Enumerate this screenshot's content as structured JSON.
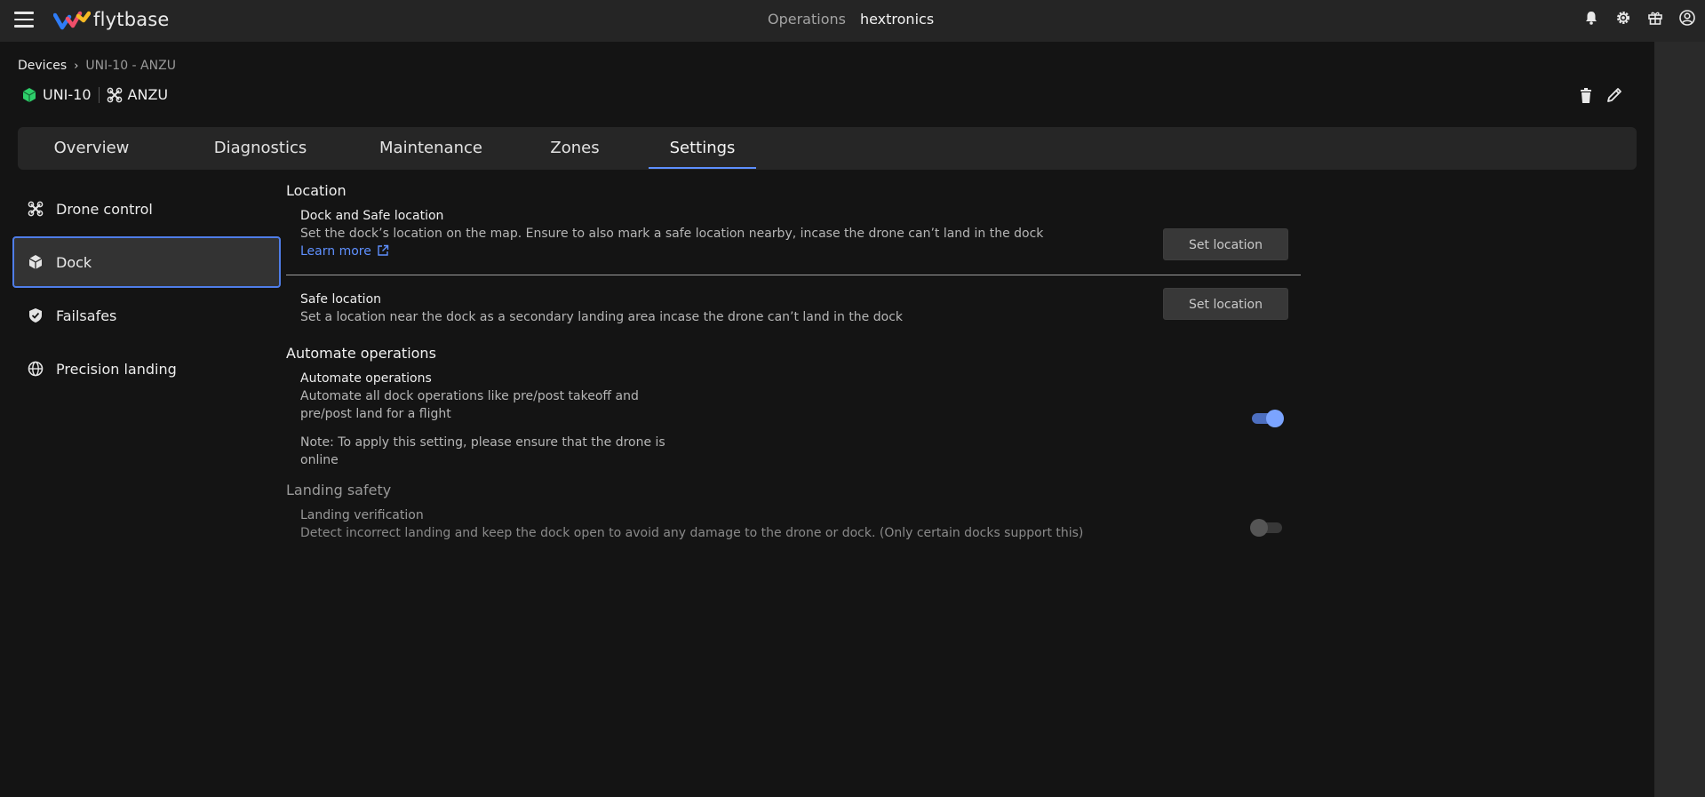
{
  "app": {
    "brand": "flytbase"
  },
  "topbar": {
    "operations_label": "Operations",
    "org_label": "hextronics"
  },
  "breadcrumb": {
    "root": "Devices",
    "current": "UNI-10 - ANZU"
  },
  "device": {
    "dock_name": "UNI-10",
    "drone_name": "ANZU"
  },
  "tabs": [
    {
      "label": "Overview"
    },
    {
      "label": "Diagnostics"
    },
    {
      "label": "Maintenance"
    },
    {
      "label": "Zones"
    },
    {
      "label": "Settings"
    }
  ],
  "active_tab": "Settings",
  "sidenav": [
    {
      "label": "Drone control",
      "icon": "drone-icon"
    },
    {
      "label": "Dock",
      "icon": "dock-cube-icon"
    },
    {
      "label": "Failsafes",
      "icon": "shield-check-icon"
    },
    {
      "label": "Precision landing",
      "icon": "globe-icon"
    }
  ],
  "active_sidenav": "Dock",
  "sections": {
    "location": {
      "title": "Location",
      "dock_safe": {
        "title": "Dock and Safe location",
        "desc": "Set the dock’s location on the map. Ensure to also mark a safe location nearby, incase the drone can’t land in the dock",
        "learn_more": "Learn more",
        "button": "Set location"
      },
      "safe": {
        "title": "Safe location",
        "desc": "Set a location near the dock as a secondary landing area incase the drone can’t land in the dock",
        "button": "Set location"
      }
    },
    "automate": {
      "title": "Automate operations",
      "item_title": "Automate operations",
      "desc_line1": "Automate all dock operations like pre/post takeoff and",
      "desc_line2": "pre/post land for a flight",
      "note_line1": "Note: To apply this setting, please ensure that the drone is",
      "note_line2": "online",
      "enabled": true
    },
    "landing": {
      "title": "Landing safety",
      "item_title": "Landing verification",
      "desc": "Detect incorrect landing and keep the dock open to avoid any damage to the drone or dock. (Only certain docks support this)",
      "enabled": false
    }
  },
  "colors": {
    "accent": "#5d8fff",
    "link": "#5f90ff",
    "background": "#141414",
    "panel": "#262626",
    "dock_green": "#2ecf6a"
  }
}
